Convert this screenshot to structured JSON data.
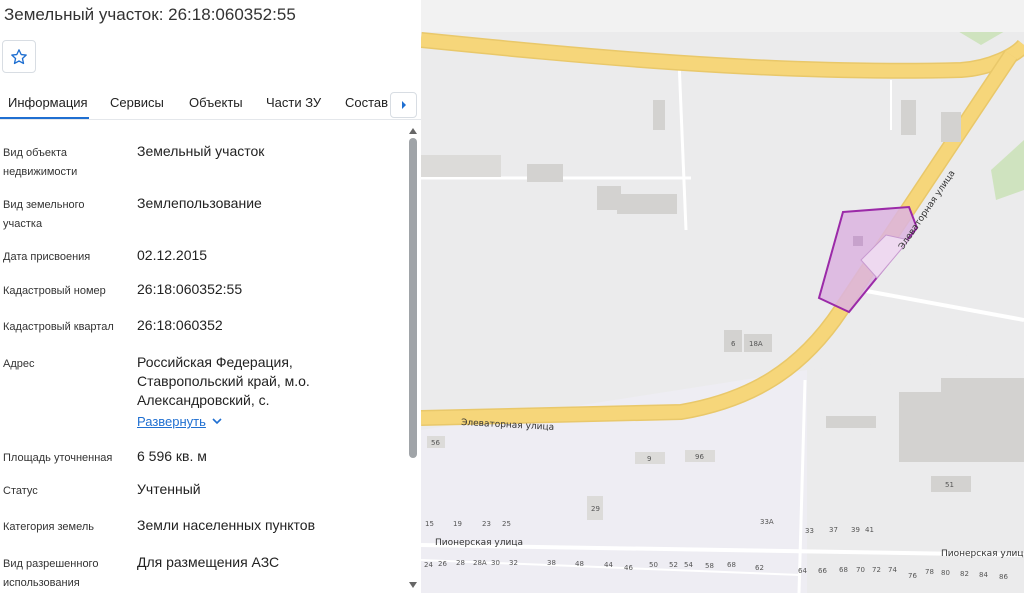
{
  "title": "Земельный участок: 26:18:060352:55",
  "tabs": [
    {
      "label": "Информация"
    },
    {
      "label": "Сервисы"
    },
    {
      "label": "Объекты"
    },
    {
      "label": "Части ЗУ"
    },
    {
      "label": "Состав"
    }
  ],
  "rows": [
    {
      "label": "Вид объекта недвижимости",
      "value": "Земельный участок"
    },
    {
      "label": "Вид земельного участка",
      "value": "Землепользование"
    },
    {
      "label": "Дата присвоения",
      "value": "02.12.2015"
    },
    {
      "label": "Кадастровый номер",
      "value": "26:18:060352:55"
    },
    {
      "label": "Кадастровый квартал",
      "value": "26:18:060352"
    },
    {
      "label": "Адрес",
      "value": "Российская Федерация, Ставропольский край, м.о. Александровский, с."
    },
    {
      "label": "Площадь уточненная",
      "value": "6 596 кв. м"
    },
    {
      "label": "Статус",
      "value": "Учтенный"
    },
    {
      "label": "Категория земель",
      "value": "Земли населенных пунктов"
    },
    {
      "label": "Вид разрешенного использования",
      "value": "Для размещения АЗС"
    }
  ],
  "expand_label": "Развернуть",
  "map": {
    "streets": [
      "Элеваторная улица",
      "Элеваторная улица",
      "Пионерская улица",
      "Пионерская улица"
    ],
    "house_numbers": [
      "6",
      "18А",
      "56",
      "9",
      "96",
      "29",
      "51",
      "15",
      "19",
      "23",
      "25",
      "33А",
      "33",
      "37",
      "39",
      "41",
      "24",
      "26",
      "28",
      "28А",
      "30",
      "32",
      "38",
      "48",
      "44",
      "46",
      "50",
      "52",
      "54",
      "58",
      "68",
      "62",
      "64",
      "66",
      "68",
      "70",
      "72",
      "74",
      "76",
      "78",
      "80",
      "82",
      "84",
      "86"
    ],
    "colors": {
      "parcel_fill": "#dcb4e0",
      "parcel_stroke": "#9b2aa8",
      "road": "#f6d67a"
    }
  }
}
